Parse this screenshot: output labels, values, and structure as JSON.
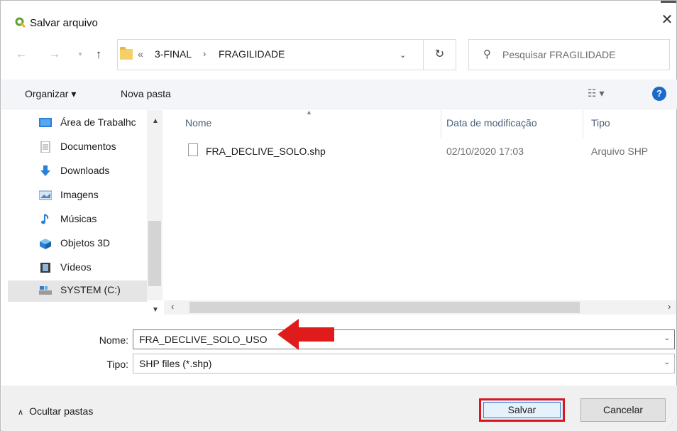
{
  "window": {
    "title": "Salvar arquivo",
    "close": "✕"
  },
  "address": {
    "overflow": "«",
    "crumbs": [
      "3-FINAL",
      "FRAGILIDADE"
    ],
    "separator": "›",
    "refresh": "↻",
    "search_placeholder": "Pesquisar FRAGILIDADE"
  },
  "toolbar": {
    "organize": "Organizar ▾",
    "new_folder": "Nova pasta",
    "view": "☷ ▾",
    "help": "?"
  },
  "nav_pane": {
    "items": [
      {
        "label": "Área de Trabalhc",
        "icon": "desktop-icon"
      },
      {
        "label": "Documentos",
        "icon": "documents-icon"
      },
      {
        "label": "Downloads",
        "icon": "downloads-icon"
      },
      {
        "label": "Imagens",
        "icon": "pictures-icon"
      },
      {
        "label": "Músicas",
        "icon": "music-icon"
      },
      {
        "label": "Objetos 3D",
        "icon": "3d-objects-icon"
      },
      {
        "label": "Vídeos",
        "icon": "videos-icon"
      },
      {
        "label": "SYSTEM (C:)",
        "icon": "drive-icon"
      }
    ]
  },
  "file_list": {
    "columns": [
      "Nome",
      "Data de modificação",
      "Tipo"
    ],
    "rows": [
      {
        "name": "FRA_DECLIVE_SOLO.shp",
        "date": "02/10/2020 17:03",
        "type": "Arquivo SHP"
      }
    ]
  },
  "form": {
    "name_label": "Nome:",
    "name_value": "FRA_DECLIVE_SOLO_USO",
    "type_label": "Tipo:",
    "type_value": "SHP files (*.shp)"
  },
  "footer": {
    "hide_folders": "Ocultar pastas",
    "save": "Salvar",
    "cancel": "Cancelar"
  },
  "colors": {
    "highlight_red": "#d9171f",
    "accent_blue": "#1b6ac9"
  }
}
